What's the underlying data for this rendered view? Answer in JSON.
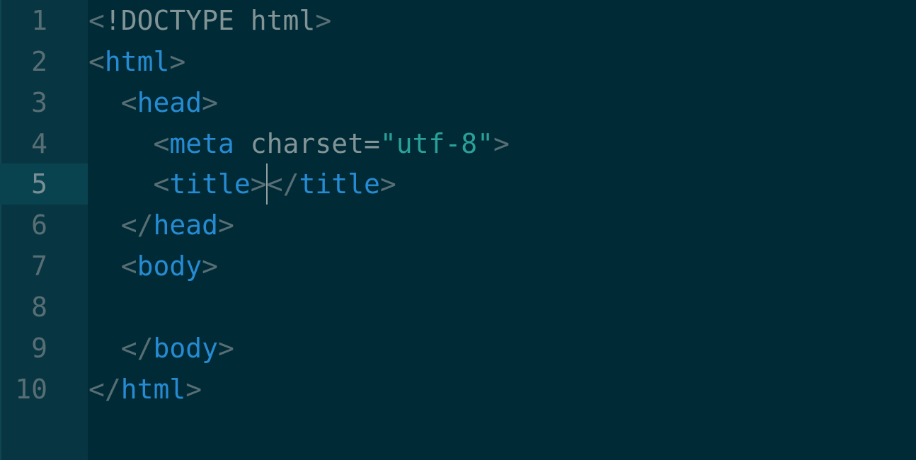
{
  "editor": {
    "language": "html",
    "theme_colors": {
      "background": "#002b36",
      "gutter": "#073642",
      "tag": "#268bd2",
      "string": "#2aa198",
      "punctuation": "#586e75",
      "text": "#839496"
    },
    "current_line": 5,
    "lines": [
      {
        "number": "1",
        "parts": [
          "<",
          "!DOCTYPE html",
          ">"
        ]
      },
      {
        "number": "2",
        "parts": [
          "<",
          "html",
          ">"
        ]
      },
      {
        "number": "3",
        "parts": [
          "  ",
          "<",
          "head",
          ">"
        ]
      },
      {
        "number": "4",
        "parts": [
          "    ",
          "<",
          "meta",
          " charset",
          "=",
          "\"utf-8\"",
          ">"
        ]
      },
      {
        "number": "5",
        "parts": [
          "    ",
          "<",
          "title",
          ">",
          "</",
          "title",
          ">"
        ]
      },
      {
        "number": "6",
        "parts": [
          "  ",
          "</",
          "head",
          ">"
        ]
      },
      {
        "number": "7",
        "parts": [
          "  ",
          "<",
          "body",
          ">"
        ]
      },
      {
        "number": "8",
        "parts": [
          ""
        ]
      },
      {
        "number": "9",
        "parts": [
          "  ",
          "</",
          "body",
          ">"
        ]
      },
      {
        "number": "10",
        "parts": [
          "</",
          "html",
          ">"
        ]
      }
    ]
  }
}
